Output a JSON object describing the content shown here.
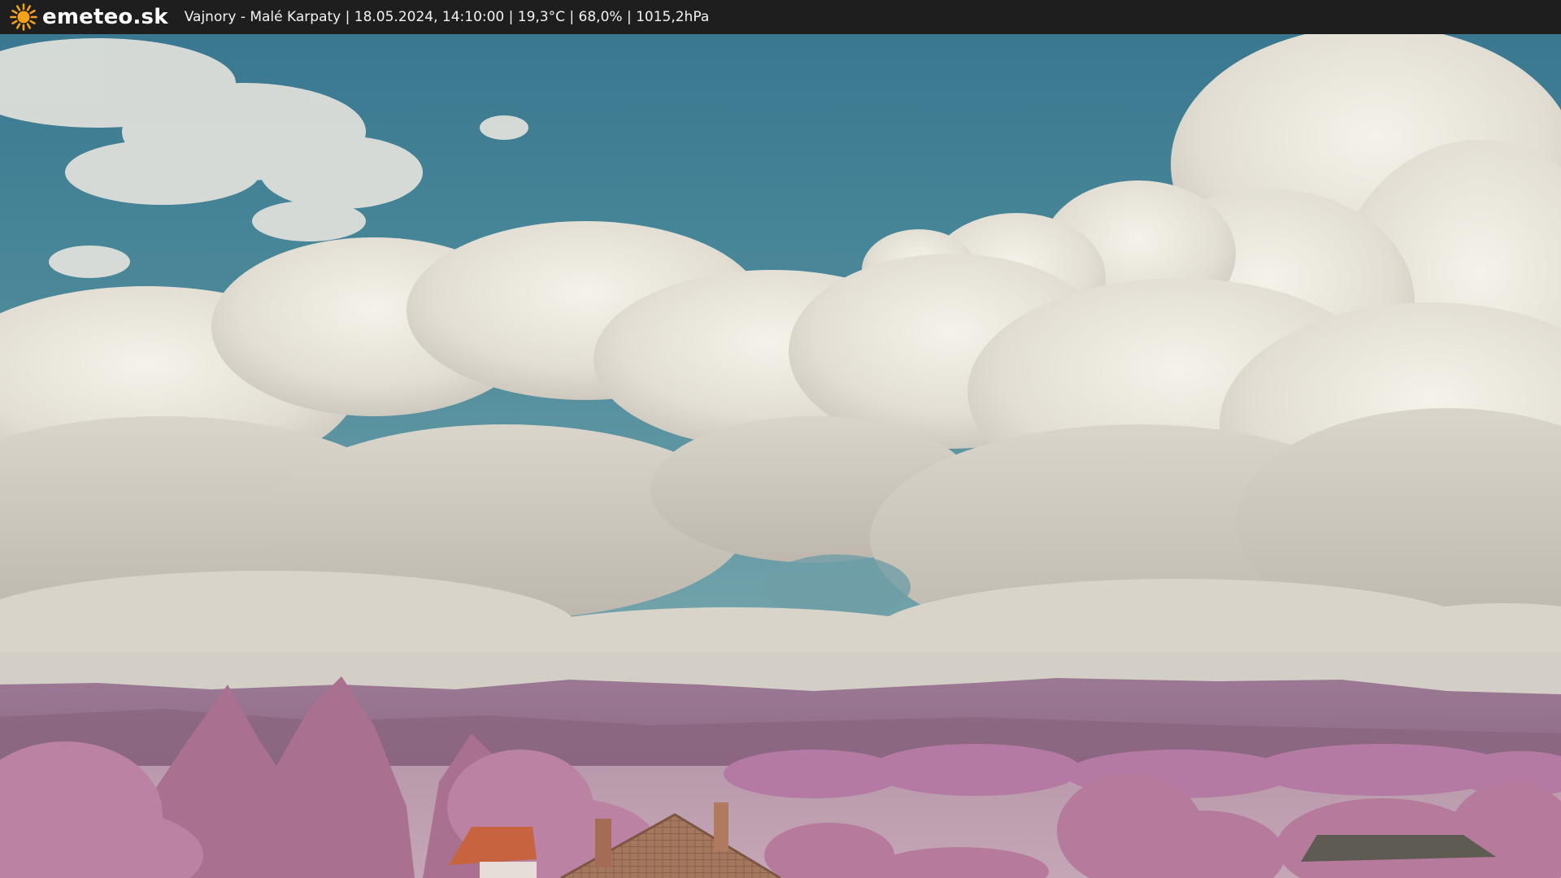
{
  "header": {
    "logo_icon": "sun-icon",
    "brand": "emeteo.sk",
    "info": "Vajnory - Malé Karpaty | 18.05.2024, 14:10:00 | 19,3°C | 68,0% | 1015,2hPa"
  },
  "colors": {
    "bar": "#1e1e1e",
    "sun": "#f3a21a",
    "sky": "#3f7f95",
    "foliage": "#b87aa8",
    "roof": "#c7643f"
  }
}
